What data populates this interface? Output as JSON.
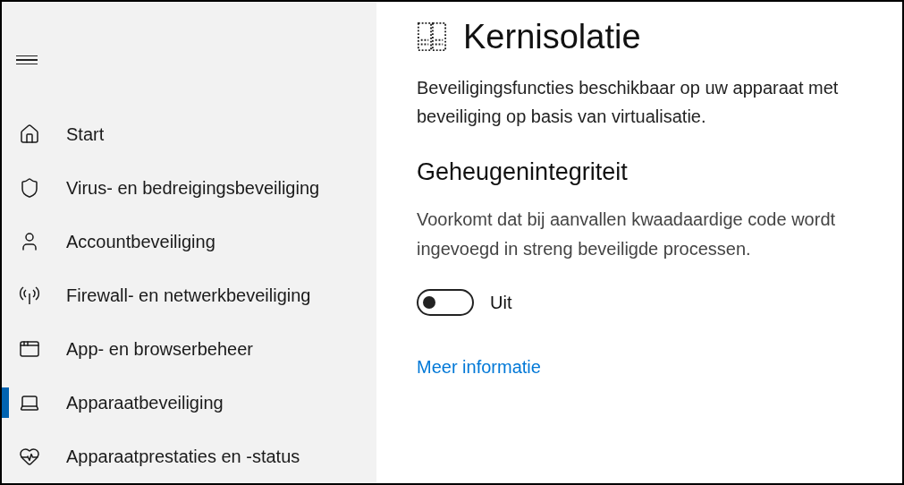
{
  "sidebar": {
    "items": [
      {
        "kind": "home",
        "label": "Start",
        "selected": false
      },
      {
        "kind": "shield",
        "label": "Virus- en bedreigingsbeveiliging",
        "selected": false
      },
      {
        "kind": "person",
        "label": "Accountbeveiliging",
        "selected": false
      },
      {
        "kind": "antenna",
        "label": "Firewall- en netwerkbeveiliging",
        "selected": false
      },
      {
        "kind": "window",
        "label": "App- en browserbeheer",
        "selected": false
      },
      {
        "kind": "laptop",
        "label": "Apparaatbeveiliging",
        "selected": true
      },
      {
        "kind": "heart",
        "label": "Apparaatprestaties en -status",
        "selected": false
      }
    ]
  },
  "page": {
    "title": "Kernisolatie",
    "description": "Beveiligingsfuncties beschikbaar op uw apparaat met beveiliging op basis van virtualisatie.",
    "section": {
      "heading": "Geheugenintegriteit",
      "description": "Voorkomt dat bij aanvallen kwaadaardige code wordt ingevoegd in streng beveiligde processen.",
      "toggle": {
        "on": false,
        "label": "Uit"
      }
    },
    "link": "Meer informatie"
  }
}
